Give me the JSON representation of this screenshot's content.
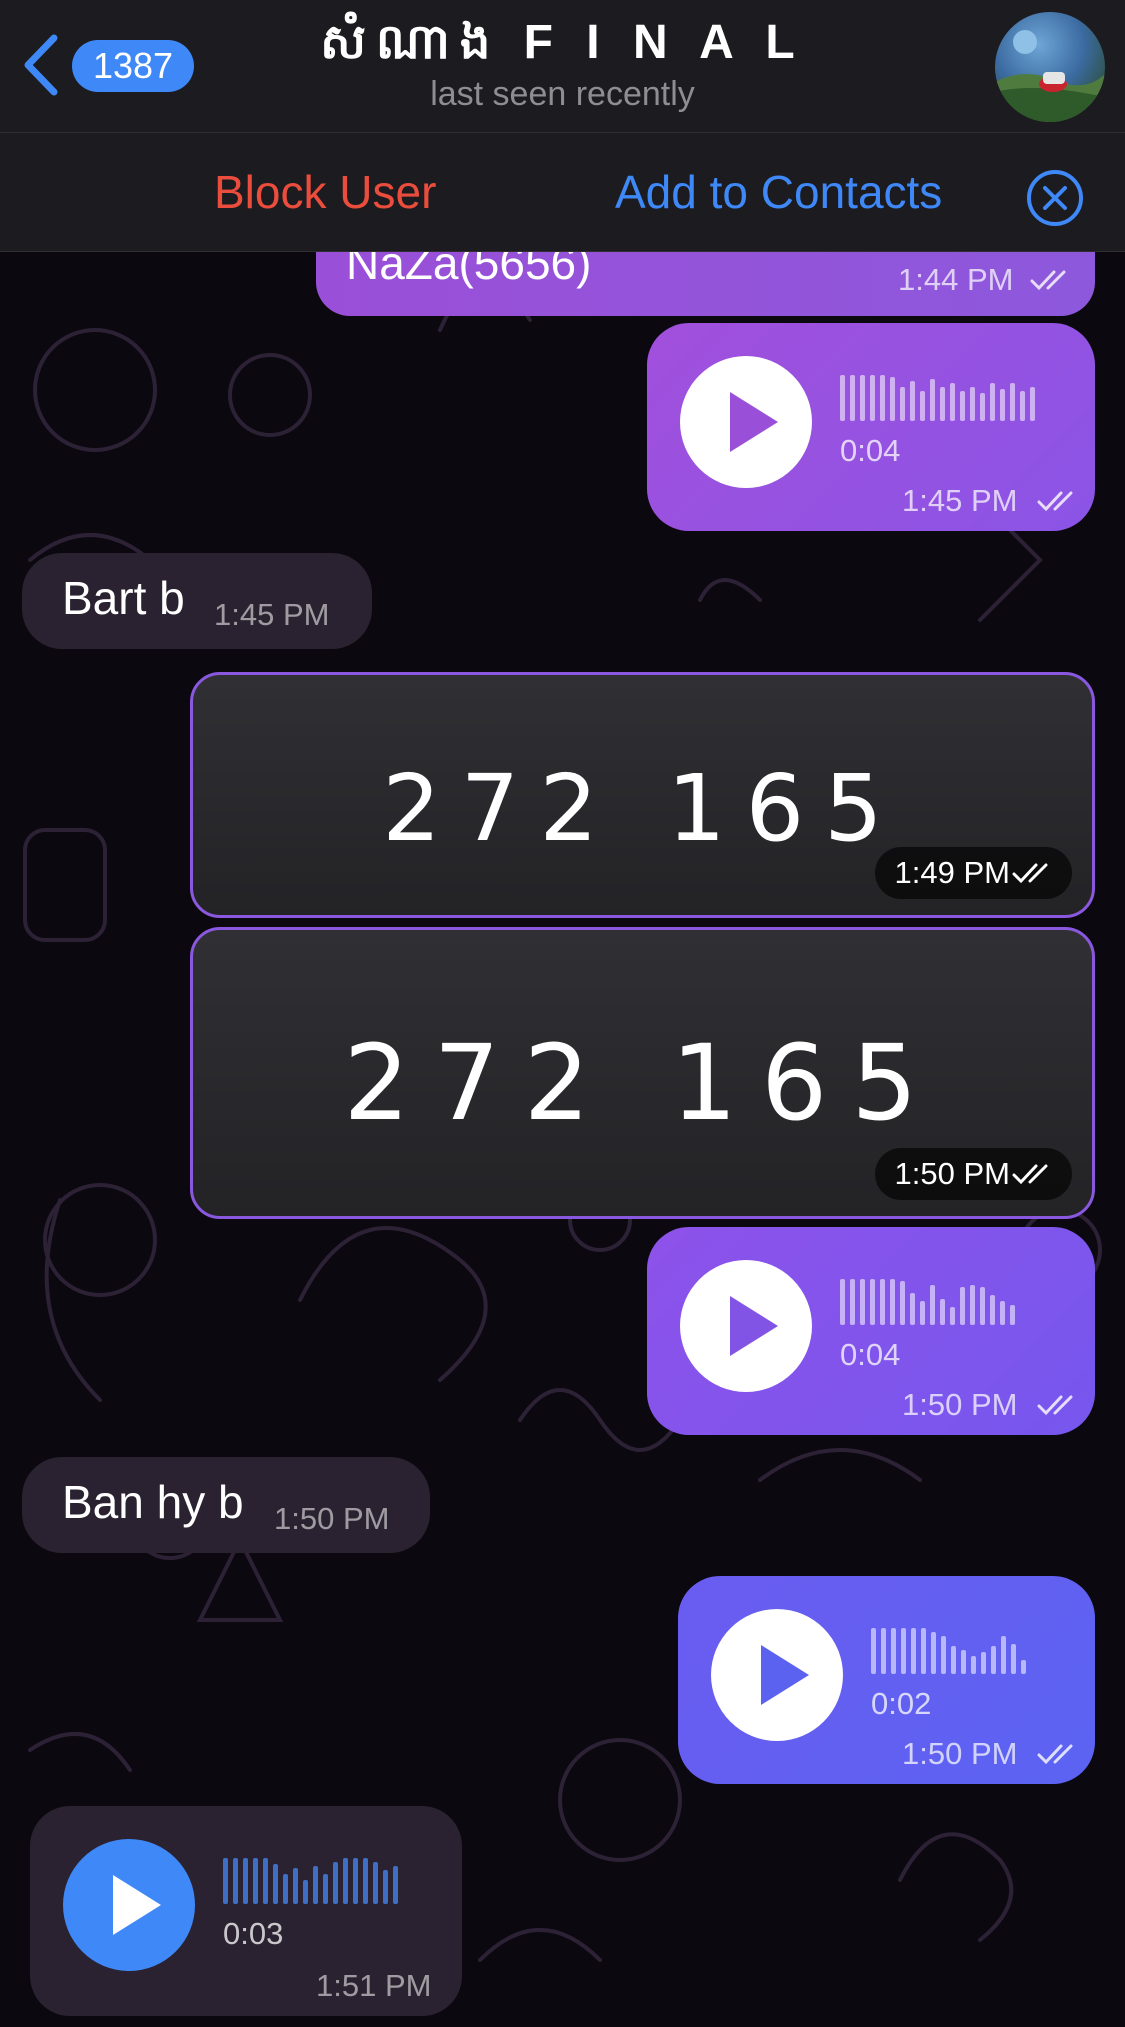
{
  "header": {
    "back_count": "1387",
    "title": "សំណាង F I N A L",
    "subtitle": "last seen recently"
  },
  "action_bar": {
    "block_label": "Block User",
    "add_label": "Add to Contacts"
  },
  "messages": [
    {
      "type": "outgoing-text",
      "text": "NaZa(5656)",
      "time": "1:44 PM"
    },
    {
      "type": "outgoing-voice",
      "duration": "0:04",
      "time": "1:45 PM"
    },
    {
      "type": "incoming-text",
      "text": "Bart b",
      "time": "1:45 PM"
    },
    {
      "type": "outgoing-photo",
      "code": "272 165",
      "time": "1:49 PM"
    },
    {
      "type": "outgoing-photo",
      "code": "272 165",
      "time": "1:50 PM"
    },
    {
      "type": "outgoing-voice",
      "duration": "0:04",
      "time": "1:50 PM"
    },
    {
      "type": "incoming-text",
      "text": "Ban hy b",
      "time": "1:50 PM"
    },
    {
      "type": "outgoing-voice",
      "duration": "0:02",
      "time": "1:50 PM"
    },
    {
      "type": "incoming-voice",
      "duration": "0:03",
      "time": "1:51 PM"
    }
  ],
  "colors": {
    "accent_blue": "#3e88f7",
    "block_red": "#eb4d3d",
    "outgoing_purple": "#9a4fd8",
    "incoming_bg": "#2a2230"
  },
  "icons": [
    "back-chevron-icon",
    "close-circle-icon",
    "play-icon",
    "double-check-icon",
    "waveform-icon"
  ]
}
